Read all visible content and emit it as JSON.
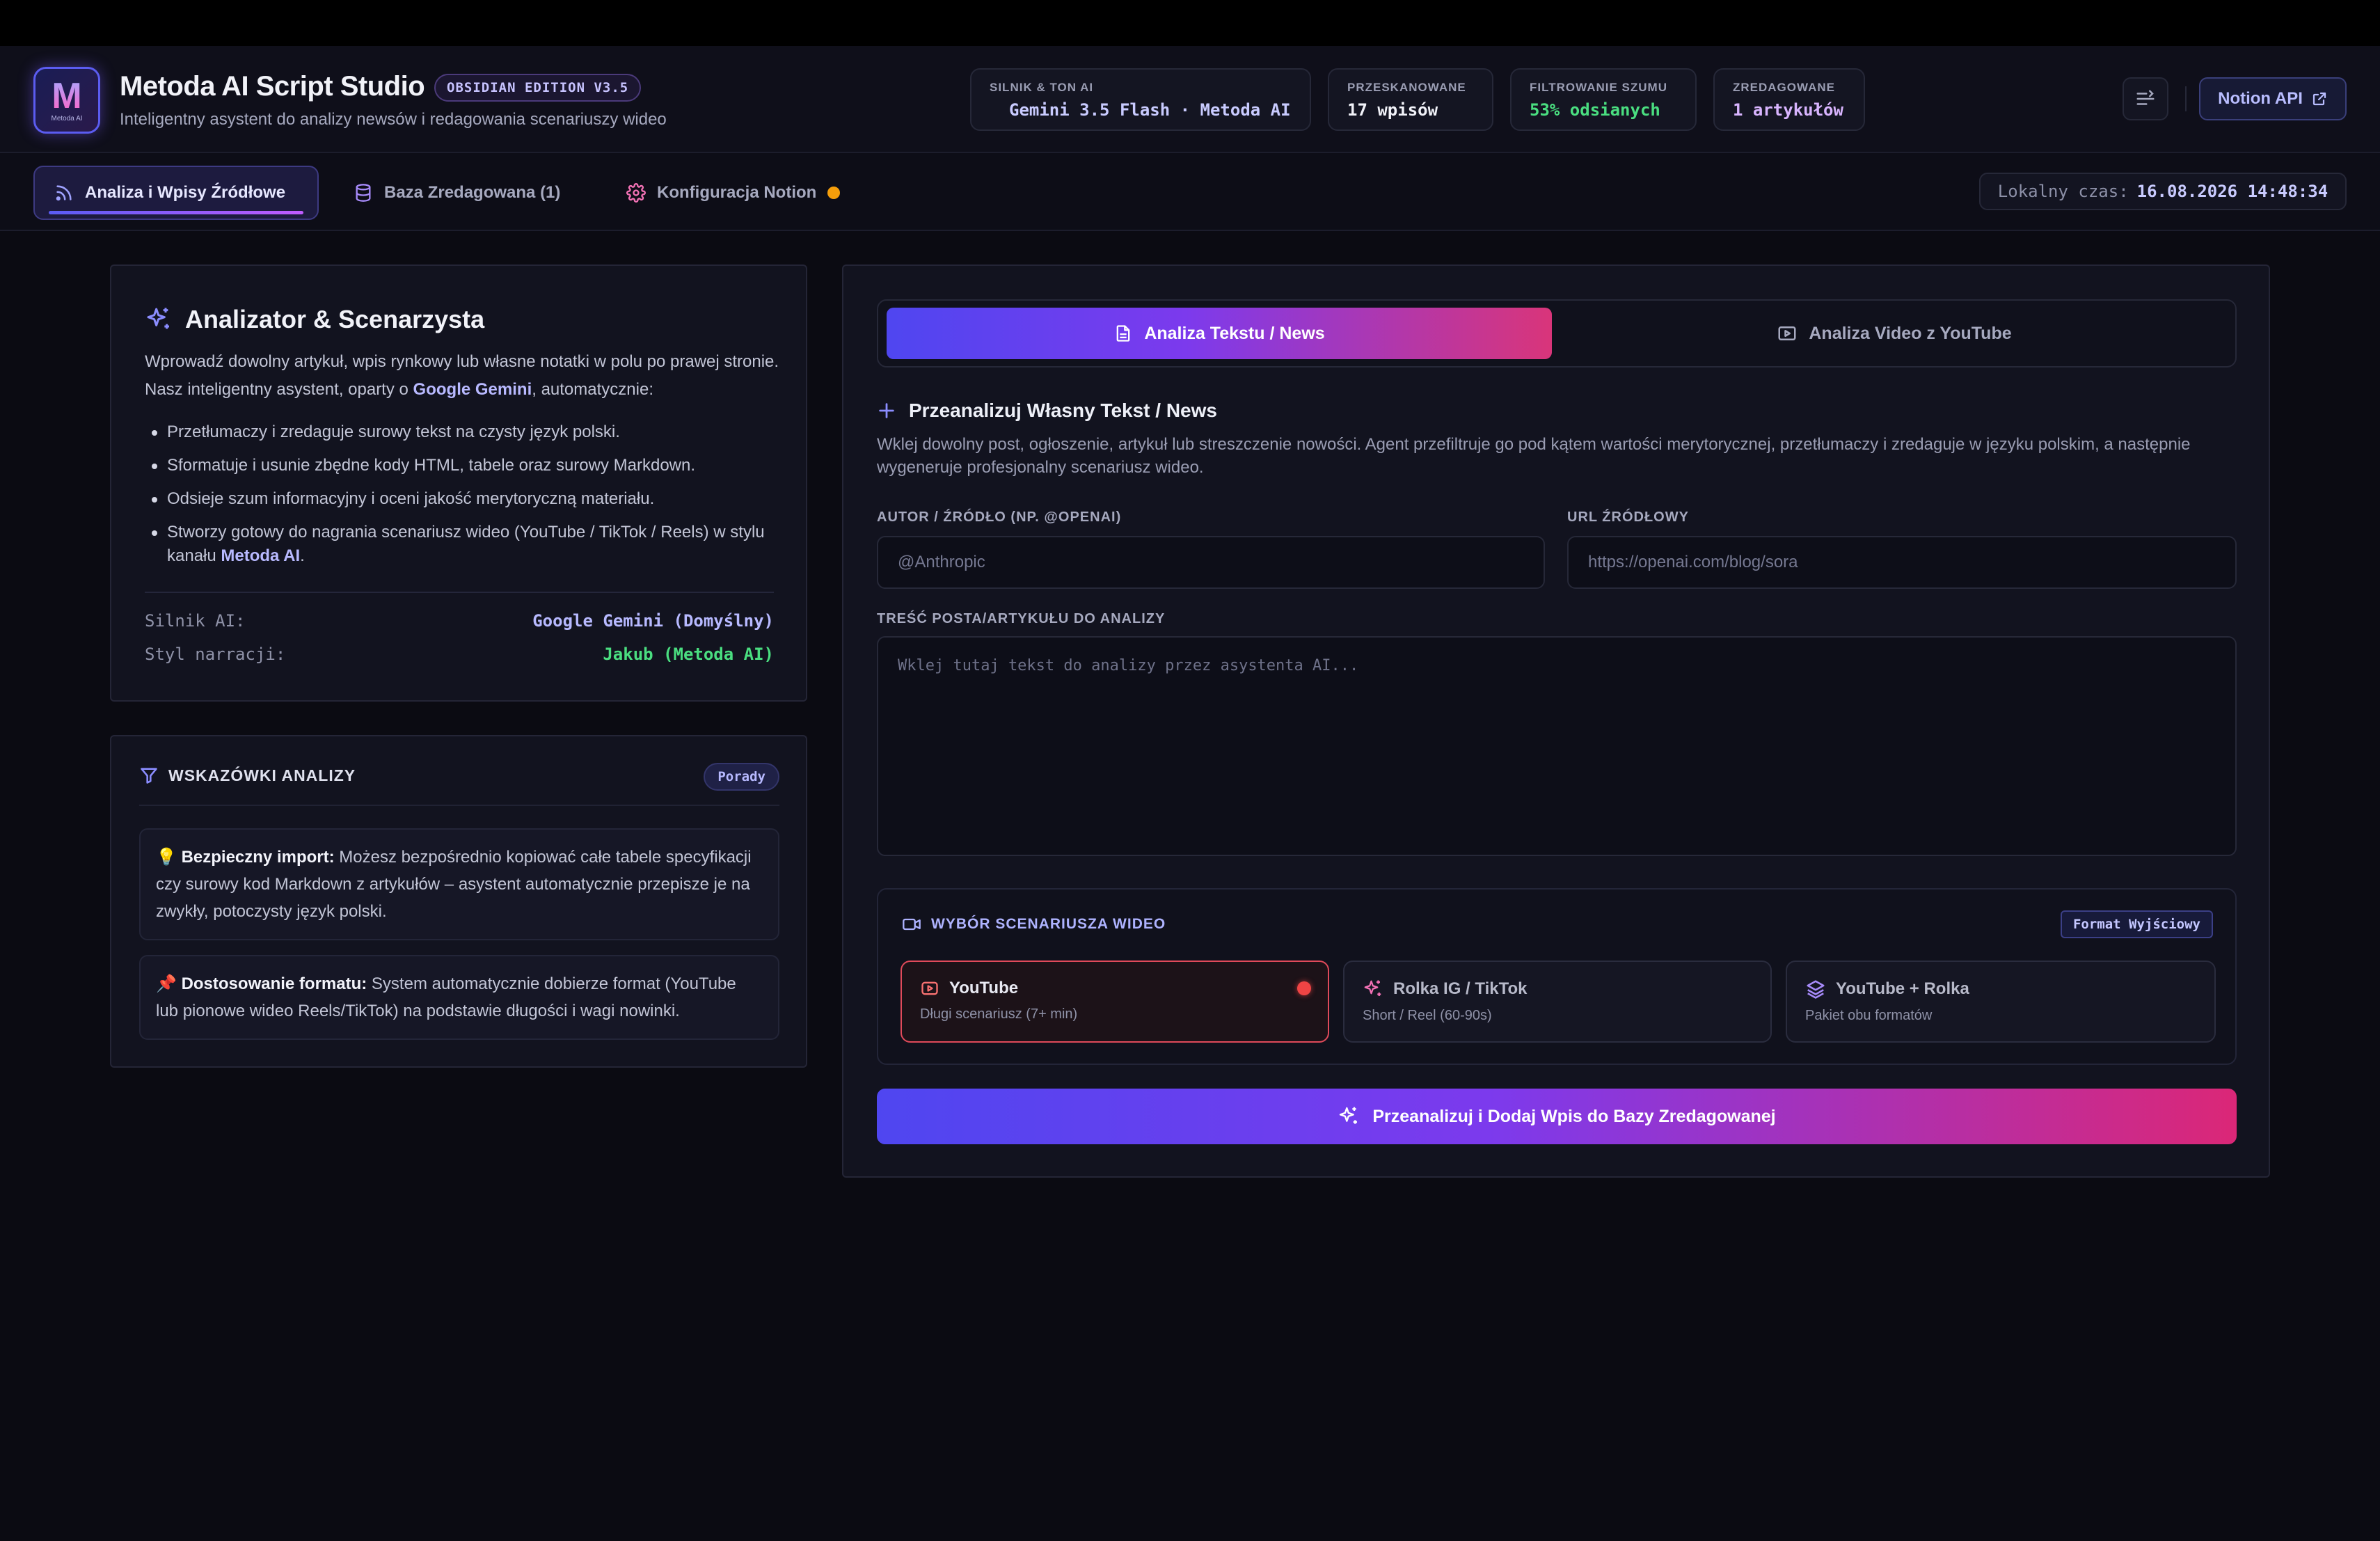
{
  "app": {
    "logo_text": "M",
    "logo_sub": "Metoda AI",
    "title": "Metoda AI Script Studio",
    "edition": "OBSIDIAN EDITION V3.5",
    "subtitle": "Inteligentny asystent do analizy newsów i redagowania scenariuszy wideo"
  },
  "stats": [
    {
      "label": "SILNIK & TON AI",
      "value": "Gemini 3.5 Flash · Metoda AI",
      "color": "#c9cbff"
    },
    {
      "label": "PRZESKANOWANE",
      "value": "17 wpisów",
      "color": "#f1f2f8"
    },
    {
      "label": "FILTROWANIE SZUMU",
      "value": "53% odsianych",
      "color": "#4ade80"
    },
    {
      "label": "ZREDAGOWANE",
      "value": "1 artykułów",
      "color": "#d8b4fe"
    }
  ],
  "header_actions": {
    "notion_button": "Notion API"
  },
  "nav": {
    "tabs": [
      {
        "label": "Analiza i Wpisy Źródłowe",
        "icon": "rss-icon",
        "active": true
      },
      {
        "label": "Baza Zredagowana (1)",
        "icon": "database-icon",
        "active": false
      },
      {
        "label": "Konfiguracja Notion",
        "icon": "gear-icon",
        "active": false,
        "warning": true
      }
    ],
    "clock_label": "Lokalny czas:",
    "clock_value": "16.08.2026 14:48:34"
  },
  "analyzer": {
    "title": "Analizator & Scenarzysta",
    "desc_pre": "Wprowadź dowolny artykuł, wpis rynkowy lub własne notatki w polu po prawej stronie. Nasz inteligentny asystent, oparty o ",
    "desc_bold": "Google Gemini",
    "desc_post": ", automatycznie:",
    "bullets": [
      "Przetłumaczy i zredaguje surowy tekst na czysty język polski.",
      "Sformatuje i usunie zbędne kody HTML, tabele oraz surowy Markdown.",
      "Odsieje szum informacyjny i oceni jakość merytoryczną materiału."
    ],
    "bullet4_pre": "Stworzy gotowy do nagrania scenariusz wideo (YouTube / TikTok / Reels) w stylu kanału ",
    "bullet4_bold": "Metoda AI",
    "bullet4_post": ".",
    "engine_label": "Silnik AI:",
    "engine_value": "Google Gemini (Domyślny)",
    "engine_color": "#b7b9ff",
    "style_label": "Styl narracji:",
    "style_value": "Jakub (Metoda AI)",
    "style_color": "#4ade80"
  },
  "tips": {
    "title": "WSKAZÓWKI ANALIZY",
    "badge": "Porady",
    "items": [
      {
        "emoji": "💡",
        "bold": "Bezpieczny import:",
        "text": " Możesz bezpośrednio kopiować całe tabele specyfikacji czy surowy kod Markdown z artykułów – asystent automatycznie przepisze je na zwykły, potoczysty język polski."
      },
      {
        "emoji": "📌",
        "bold": "Dostosowanie formatu:",
        "text": " System automatycznie dobierze format (YouTube lub pionowe wideo Reels/TikTok) na podstawie długości i wagi nowinki."
      }
    ]
  },
  "modes": {
    "text": "Analiza Tekstu / News",
    "video": "Analiza Video z YouTube"
  },
  "form": {
    "title": "Przeanalizuj Własny Tekst / News",
    "desc": "Wklej dowolny post, ogłoszenie, artykuł lub streszczenie nowości. Agent przefiltruje go pod kątem wartości merytorycznej, przetłumaczy i zredaguje w języku polskim, a następnie wygeneruje profesjonalny scenariusz wideo.",
    "author_label": "AUTOR / ŹRÓDŁO (NP. @OPENAI)",
    "author_placeholder": "@Anthropic",
    "url_label": "URL ŹRÓDŁOWY",
    "url_placeholder": "https://openai.com/blog/sora",
    "content_label": "TREŚĆ POSTA/ARTYKUŁU DO ANALIZY",
    "content_placeholder": "Wklej tutaj tekst do analizy przez asystenta AI..."
  },
  "script_choice": {
    "title": "WYBÓR SCENARIUSZA WIDEO",
    "badge": "Format Wyjściowy",
    "options": [
      {
        "name": "YouTube",
        "desc": "Długi scenariusz (7+ min)",
        "selected": true
      },
      {
        "name": "Rolka IG / TikTok",
        "desc": "Short / Reel (60-90s)",
        "selected": false
      },
      {
        "name": "YouTube + Rolka",
        "desc": "Pakiet obu formatów",
        "selected": false
      }
    ]
  },
  "cta": "Przeanalizuj i Dodaj Wpis do Bazy Zredagowanej"
}
